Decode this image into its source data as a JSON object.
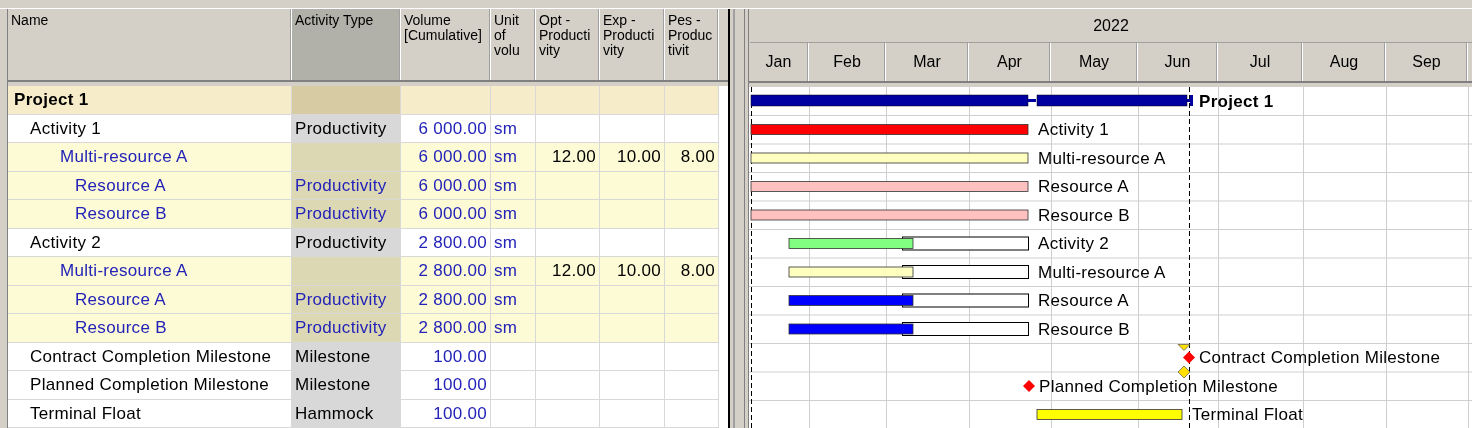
{
  "table": {
    "columns": [
      "Name",
      "Activity Type",
      "Volume [Cumulative]",
      "Unit of volu",
      "Opt -Productivity",
      "Exp -Productivity",
      "Pes -Productivit"
    ],
    "rows": [
      {
        "name": "Project 1",
        "kind": "project",
        "bar": {
          "kind": "summary",
          "color": "#0000a0",
          "label": "Project 1"
        },
        "children": [
          {
            "name": "Activity 1",
            "kind": "activity",
            "activity_type": "Productivity",
            "volume": "6 000.00",
            "unit": "sm",
            "bar": {
              "kind": "bar",
              "color": "#ff0000",
              "label": "Activity 1"
            },
            "children": [
              {
                "name": "Multi-resource A",
                "kind": "multi",
                "volume": "6 000.00",
                "unit": "sm",
                "opt": "12.00",
                "exp": "10.00",
                "pes": "8.00",
                "bar": {
                  "kind": "bar",
                  "color": "#ffffc0",
                  "label": "Multi-resource A"
                },
                "children": [
                  {
                    "name": "Resource A",
                    "kind": "resource",
                    "activity_type": "Productivity",
                    "volume": "6 000.00",
                    "unit": "sm",
                    "bar": {
                      "kind": "bar",
                      "color": "#ffc0c0",
                      "label": "Resource A"
                    }
                  },
                  {
                    "name": "Resource B",
                    "kind": "resource",
                    "activity_type": "Productivity",
                    "volume": "6 000.00",
                    "unit": "sm",
                    "bar": {
                      "kind": "bar",
                      "color": "#ffc0c0",
                      "label": "Resource B"
                    }
                  }
                ]
              }
            ]
          },
          {
            "name": "Activity 2",
            "kind": "activity",
            "activity_type": "Productivity",
            "volume": "2 800.00",
            "unit": "sm",
            "bar": {
              "kind": "progress",
              "color": "#80ff80",
              "label": "Activity 2"
            },
            "children": [
              {
                "name": "Multi-resource A",
                "kind": "multi",
                "volume": "2 800.00",
                "unit": "sm",
                "opt": "12.00",
                "exp": "10.00",
                "pes": "8.00",
                "bar": {
                  "kind": "progress",
                  "color": "#ffffc0",
                  "label": "Multi-resource A"
                },
                "children": [
                  {
                    "name": "Resource A",
                    "kind": "resource",
                    "activity_type": "Productivity",
                    "volume": "2 800.00",
                    "unit": "sm",
                    "bar": {
                      "kind": "progress",
                      "color": "#0000ff",
                      "label": "Resource A"
                    }
                  },
                  {
                    "name": "Resource B",
                    "kind": "resource",
                    "activity_type": "Productivity",
                    "volume": "2 800.00",
                    "unit": "sm",
                    "bar": {
                      "kind": "progress",
                      "color": "#0000ff",
                      "label": "Resource B"
                    }
                  }
                ]
              }
            ]
          },
          {
            "name": "Contract Completion Milestone",
            "kind": "activity",
            "activity_type": "Milestone",
            "volume": "100.00",
            "bar": {
              "kind": "milestone",
              "color": "#ff0000",
              "label": "Contract Completion Milestone"
            }
          },
          {
            "name": "Planned Completion Milestone",
            "kind": "activity",
            "activity_type": "Milestone",
            "volume": "100.00",
            "bar": {
              "kind": "milestone",
              "color": "#ff0000",
              "label": "Planned Completion Milestone"
            }
          },
          {
            "name": "Terminal Float",
            "kind": "activity",
            "activity_type": "Hammock",
            "volume": "100.00",
            "bar": {
              "kind": "bar",
              "color": "#ffff00",
              "label": "Terminal Float"
            }
          }
        ]
      }
    ]
  },
  "gantt": {
    "year": "2022",
    "months": [
      "Jan",
      "Feb",
      "Mar",
      "Apr",
      "May",
      "Jun",
      "Jul",
      "Aug",
      "Sep"
    ]
  }
}
